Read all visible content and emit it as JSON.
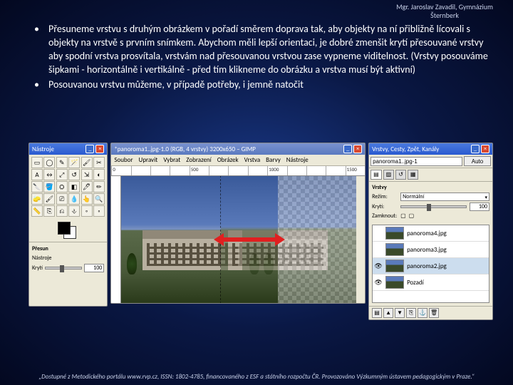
{
  "header": {
    "line1": "Mgr. Jaroslav Zavadil, Gymnázium",
    "line2": "Šternberk"
  },
  "bullets": [
    "Přesuneme vrstvu s druhým obrázkem v pořadí směrem doprava tak, aby objekty na ní přibližně lícovali s objekty na vrstvě s prvním snímkem. Abychom měli lepší orientaci, je dobré zmenšit krytí přesouvané vrstvy aby spodní vrstva prosvítala, vrstvám nad přesouvanou vrstvou zase vypneme viditelnost. (Vrstvy posouváme šipkami - horizontálně i vertikálně - před tím klikneme do obrázku a vrstva musí být aktivní)",
    "Posouvanou vrstvu můžeme, v případě potřeby, i jemně natočit"
  ],
  "toolbox": {
    "title": "Nástroje",
    "icons": [
      "▭",
      "◯",
      "✎",
      "🪄",
      "🖌",
      "✂",
      "A",
      "↔",
      "⤢",
      "↺",
      "⇲",
      "◐",
      "🔪",
      "🪣",
      "⛭",
      "◧",
      "🖊",
      "✏",
      "🧽",
      "🖌",
      "⎚",
      "💧",
      "👆",
      "🔍",
      "📏",
      "⎘",
      "⎌",
      "⎀",
      "◦",
      "◦"
    ],
    "options": {
      "label_move": "Přesun",
      "row1": "Nástroje",
      "row2_label": "Krytí",
      "row2_val": "100"
    }
  },
  "imgwin": {
    "title": "*panoroma1..jpg-1.0 (RGB, 4 vrstvy) 3200x650 – GIMP",
    "menu": [
      "Soubor",
      "Upravit",
      "Vybrat",
      "Zobrazení",
      "Obrázek",
      "Vrstva",
      "Barvy",
      "Nástroje"
    ],
    "ruler_ticks": [
      "0",
      "",
      "",
      "",
      "500",
      "",
      "",
      "",
      "1000",
      "",
      "",
      "",
      "1500"
    ]
  },
  "layersdock": {
    "title": "Vrstvy, Cesty, Zpět, Kanály",
    "file_field": "panoroma1..jpg-1",
    "auto_btn": "Auto",
    "tabs": [
      "▤",
      "▨",
      "↺",
      "▦"
    ],
    "section": "Vrstvy",
    "mode_label": "Režim:",
    "mode_value": "Normální",
    "opacity_label": "Krytí:",
    "opacity_value": "100",
    "lock_label": "Zamknout:",
    "layers": [
      {
        "name": "panoroma4.jpg",
        "vis": ""
      },
      {
        "name": "panoroma3.jpg",
        "vis": ""
      },
      {
        "name": "panoroma2.jpg",
        "vis": "👁",
        "sel": true
      },
      {
        "name": "Pozadí",
        "vis": "👁"
      }
    ],
    "btns": [
      "▤",
      "▲",
      "▼",
      "⎘",
      "⚓",
      "🗑"
    ]
  },
  "footer": "„Dostupné z Metodického portálu www.rvp.cz, ISSN: 1802-4785, financovaného z ESF a státního rozpočtu ČR. Provozováno Výzkumným ústavem pedagogickým v Praze.“"
}
